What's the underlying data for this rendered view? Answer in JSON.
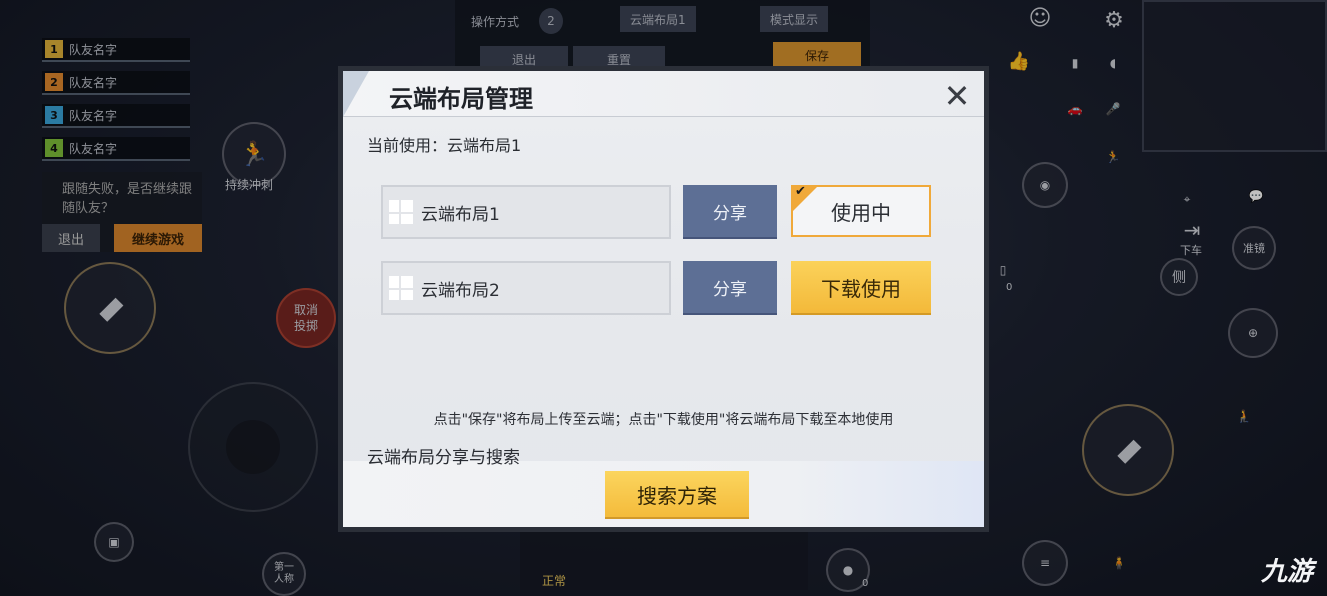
{
  "hud": {
    "team": [
      {
        "num": "1",
        "name": "队友名字",
        "color": "#e0b23a"
      },
      {
        "num": "2",
        "name": "队友名字",
        "color": "#e0882e"
      },
      {
        "num": "3",
        "name": "队友名字",
        "color": "#3aa5d8"
      },
      {
        "num": "4",
        "name": "队友名字",
        "color": "#7fbf3a"
      }
    ],
    "top_bar": {
      "mode_label": "操作方式",
      "mode_number": "2",
      "cloud_layout": "云端布局1",
      "mode_display": "模式显示",
      "exit": "退出",
      "reset": "重置",
      "save": "保存"
    },
    "follow": {
      "message": "跟随失败，是否继续跟随队友？",
      "exit": "退出",
      "continue": "继续游戏"
    },
    "sprint_label": "持续冲刺",
    "cancel_throw": "取消投掷",
    "third_person": "第一人称",
    "get_off": "下车",
    "lean": "侧",
    "aim": "准镜",
    "bullet_count": "0",
    "grenade_count": "0",
    "battery_count": "0",
    "quick_label": "正常"
  },
  "modal": {
    "title": "云端布局管理",
    "current_text": "当前使用：云端布局1",
    "layouts": [
      {
        "name": "云端布局1",
        "share": "分享",
        "status": "使用中",
        "active": true
      },
      {
        "name": "云端布局2",
        "share": "分享",
        "status": "下载使用",
        "active": false
      }
    ],
    "hint": "点击\"保存\"将布局上传至云端；点击\"下载使用\"将云端布局下载至本地使用",
    "section_title": "云端布局分享与搜索",
    "search_button": "搜索方案"
  },
  "watermark": "九游",
  "colors": {
    "accent_orange": "#f0a93a",
    "share_blue": "#5d6f95",
    "download_yellow": "#f3b93a"
  }
}
